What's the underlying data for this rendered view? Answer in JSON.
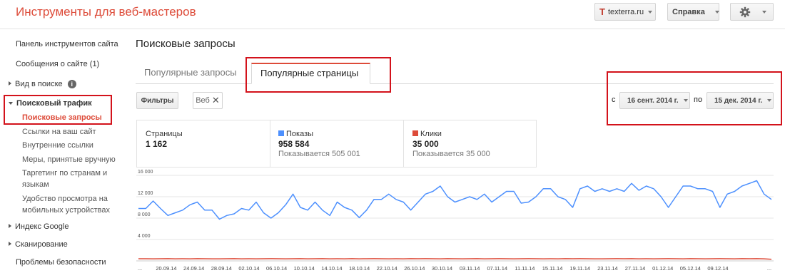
{
  "app": {
    "title": "Инструменты для веб-мастеров"
  },
  "header": {
    "site": "texterra.ru",
    "help": "Справка",
    "site_icon": "T"
  },
  "sidebar": {
    "items": [
      {
        "label": "Панель инструментов сайта"
      },
      {
        "label": "Сообщения о сайте (1)"
      },
      {
        "label": "Вид в поиске"
      },
      {
        "label": "Поисковый трафик"
      },
      {
        "label": "Поисковые запросы"
      },
      {
        "label": "Ссылки на ваш сайт"
      },
      {
        "label": "Внутренние ссылки"
      },
      {
        "label": "Меры, принятые вручную"
      },
      {
        "label": "Таргетинг по странам и"
      },
      {
        "label": "языкам"
      },
      {
        "label": "Удобство просмотра на"
      },
      {
        "label": "мобильных устройствах"
      },
      {
        "label": "Индекс Google"
      },
      {
        "label": "Сканирование"
      },
      {
        "label": "Проблемы безопасности"
      }
    ],
    "info_icon": "i"
  },
  "main": {
    "title": "Поисковые запросы",
    "tabs": [
      {
        "label": "Популярные запросы"
      },
      {
        "label": "Популярные страницы"
      }
    ],
    "filters_label": "Фильтры",
    "web_chip": "Веб",
    "date_from_label": "с",
    "date_from": "16 сент. 2014 г.",
    "date_to_label": "по",
    "date_to": "15 дек. 2014 г."
  },
  "stats": {
    "pages_label": "Страницы",
    "pages_value": "1 162",
    "shows_label": "Показы",
    "shows_value": "958 584",
    "shows_prev": "Показывается 505 001",
    "clicks_label": "Клики",
    "clicks_value": "35 000",
    "clicks_prev": "Показывается 35 000"
  },
  "colors": {
    "accent_red": "#dd4b39",
    "shows": "#4d90fe",
    "clicks": "#dd4b39",
    "highlight": "#d3121b"
  },
  "chart_data": {
    "type": "line",
    "y_ticks": [
      "16 000",
      "12 000",
      "8 000",
      "4 000"
    ],
    "ylim": [
      0,
      16000
    ],
    "x_labels": [
      "...",
      "20.09.14",
      "24.09.14",
      "28.09.14",
      "02.10.14",
      "06.10.14",
      "10.10.14",
      "14.10.14",
      "18.10.14",
      "22.10.14",
      "26.10.14",
      "30.10.14",
      "03.11.14",
      "07.11.14",
      "11.11.14",
      "15.11.14",
      "19.11.14",
      "23.11.14",
      "27.11.14",
      "01.12.14",
      "05.12.14",
      "09.12.14",
      "..."
    ],
    "series": [
      {
        "name": "Показы",
        "values": [
          9800,
          9800,
          11200,
          9800,
          8500,
          9000,
          9500,
          10500,
          11000,
          9500,
          9500,
          7800,
          8500,
          8800,
          9800,
          9500,
          11000,
          9000,
          8000,
          9000,
          10500,
          12500,
          10000,
          9500,
          11000,
          9500,
          8500,
          11000,
          10000,
          9500,
          8100,
          9500,
          11500,
          11500,
          12500,
          11500,
          11000,
          9500,
          11000,
          12500,
          13000,
          14000,
          12000,
          11000,
          11500,
          12000,
          11500,
          12500,
          11000,
          12000,
          13000,
          13000,
          10800,
          11000,
          12000,
          13500,
          13500,
          12000,
          11500,
          10000,
          13500,
          14000,
          13000,
          13500,
          13000,
          13500,
          13000,
          14500,
          13200,
          14000,
          13500,
          12000,
          10000,
          12000,
          14000,
          14000,
          13500,
          13500,
          13000,
          10000,
          12500,
          13000,
          14000,
          14500,
          15000,
          12500,
          11500
        ],
        "color": "#4d90fe"
      },
      {
        "name": "Клики",
        "values": [
          400,
          400,
          380,
          400,
          420,
          390,
          400,
          380,
          410,
          400,
          390,
          380,
          400,
          410,
          390,
          400,
          380,
          400,
          420,
          400,
          380,
          400,
          410,
          390,
          400,
          420,
          380,
          400,
          390,
          410,
          380,
          400,
          420,
          400,
          390,
          400,
          380,
          410,
          400,
          420,
          400,
          390,
          410,
          400,
          380,
          400,
          420,
          390,
          400,
          410,
          400,
          380,
          400,
          420,
          400,
          390,
          400,
          380,
          410,
          400,
          420,
          400,
          390,
          380,
          400,
          410,
          400,
          420,
          390,
          400,
          380,
          400,
          410,
          400,
          390,
          420,
          400,
          380,
          400,
          410,
          400,
          390,
          420,
          400,
          410,
          380,
          300
        ],
        "color": "#dd4b39"
      }
    ]
  }
}
